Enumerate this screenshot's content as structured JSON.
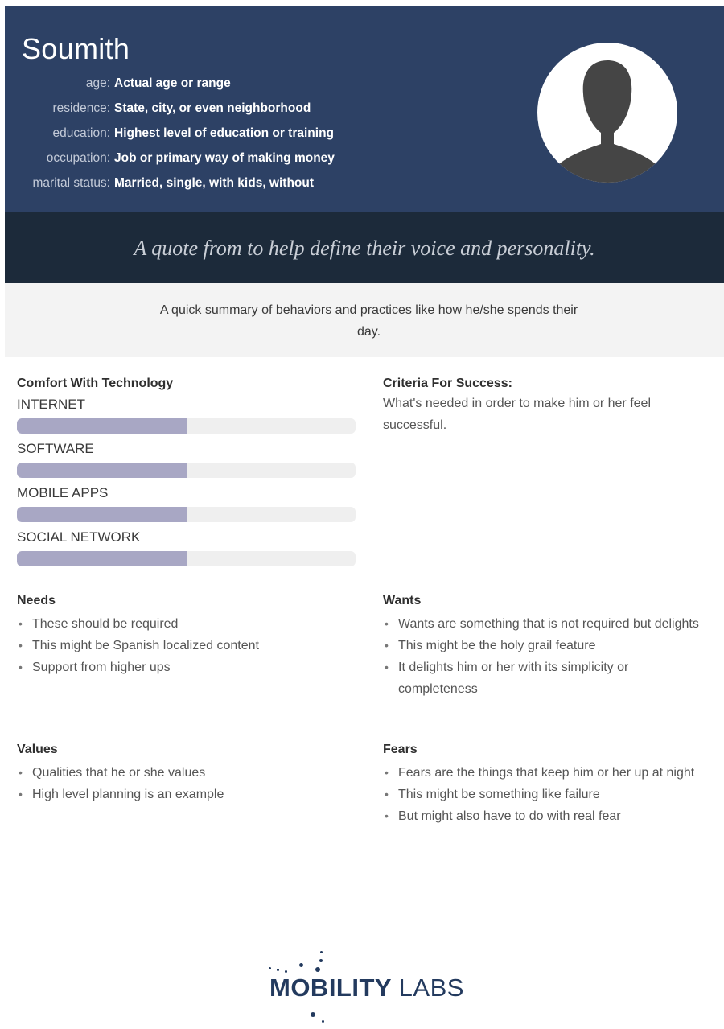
{
  "persona": {
    "name": "Soumith",
    "fields": [
      {
        "label": "age:",
        "value": "Actual age or range"
      },
      {
        "label": "residence:",
        "value": "State, city, or even neighborhood"
      },
      {
        "label": "education:",
        "value": "Highest level of education or training"
      },
      {
        "label": "occupation:",
        "value": "Job or primary way of making money"
      },
      {
        "label": "marital status:",
        "value": "Married, single, with kids, without"
      }
    ],
    "avatar_icon": "person-silhouette-icon"
  },
  "quote": "A quote from to help define their voice and personality.",
  "summary": "A quick summary of behaviors and practices like how he/she spends their day.",
  "comfort": {
    "title": "Comfort With Technology",
    "skills": [
      {
        "label": "INTERNET",
        "level": 0.5
      },
      {
        "label": "SOFTWARE",
        "level": 0.5
      },
      {
        "label": "MOBILE APPS",
        "level": 0.5
      },
      {
        "label": "SOCIAL NETWORK",
        "level": 0.5
      }
    ],
    "bar_color": "#a8a7c4"
  },
  "criteria": {
    "title": "Criteria For Success:",
    "text": "What's needed in order to make him or her feel successful."
  },
  "needs": {
    "title": "Needs",
    "items": [
      "These should be required",
      "This might be Spanish localized content",
      "Support from higher ups"
    ]
  },
  "wants": {
    "title": "Wants",
    "items": [
      "Wants are something that is not required but delights",
      "This might be the holy grail feature",
      "It delights him or her with its simplicity or completeness"
    ]
  },
  "values": {
    "title": "Values",
    "items": [
      "Qualities that he or she values",
      "High level planning is an example"
    ]
  },
  "fears": {
    "title": "Fears",
    "items": [
      "Fears are the things that keep him or her up at night",
      "This might be something like failure",
      "But might also have to do with real fear"
    ]
  },
  "logo": {
    "bold": "MOBILITY",
    "light": "LABS",
    "brand_color": "#233a5e"
  },
  "colors": {
    "header_bg": "#2d4165",
    "quote_bg": "#1c2a3a",
    "summary_bg": "#f3f3f3"
  }
}
